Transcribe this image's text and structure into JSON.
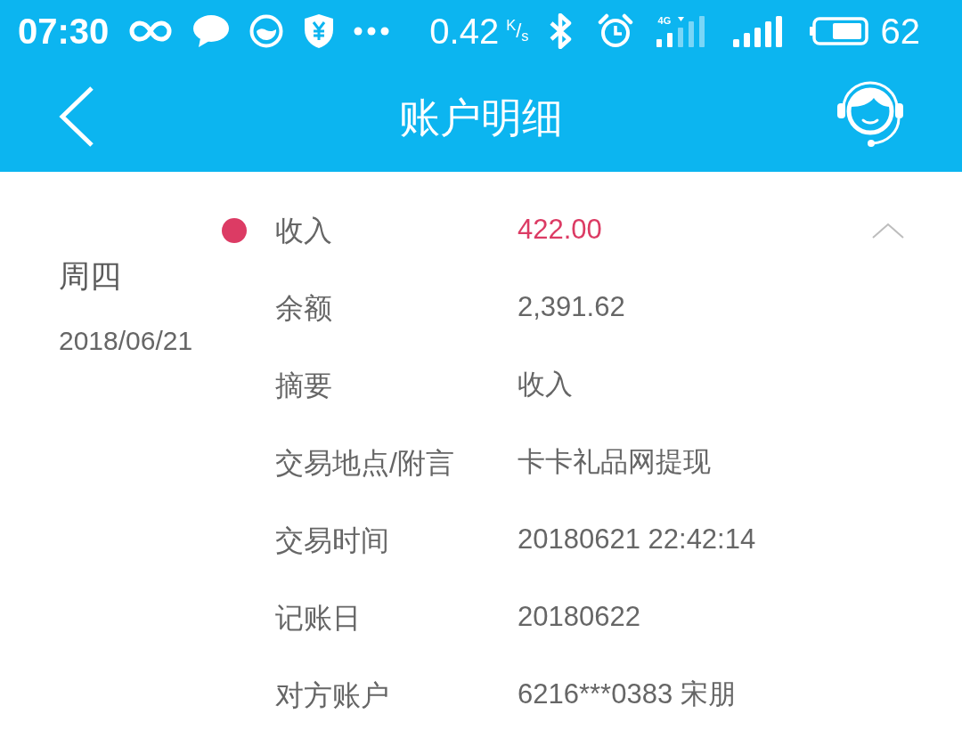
{
  "status_bar": {
    "time": "07:30",
    "net_speed": "0.42",
    "speed_unit": "$^{K}$/$_{s}$",
    "network_type": "4G",
    "battery": "62"
  },
  "header": {
    "title": "账户明细"
  },
  "transactions": [
    {
      "weekday": "周四",
      "date": "2018/06/21",
      "color": "#dc3b64",
      "expanded": true,
      "fields": [
        {
          "kind": "amount",
          "label": "收入",
          "value": "422.00"
        },
        {
          "kind": "text",
          "label": "余额",
          "value": "2,391.62"
        },
        {
          "kind": "text",
          "label": "摘要",
          "value": "收入"
        },
        {
          "kind": "text",
          "label": "交易地点/附言",
          "value": "卡卡礼品网提现"
        },
        {
          "kind": "text",
          "label": "交易时间",
          "value": "20180621 22:42:14"
        },
        {
          "kind": "text",
          "label": "记账日",
          "value": "20180622"
        },
        {
          "kind": "text",
          "label": "对方账户",
          "value": "6216***0383 宋朋"
        }
      ]
    }
  ]
}
